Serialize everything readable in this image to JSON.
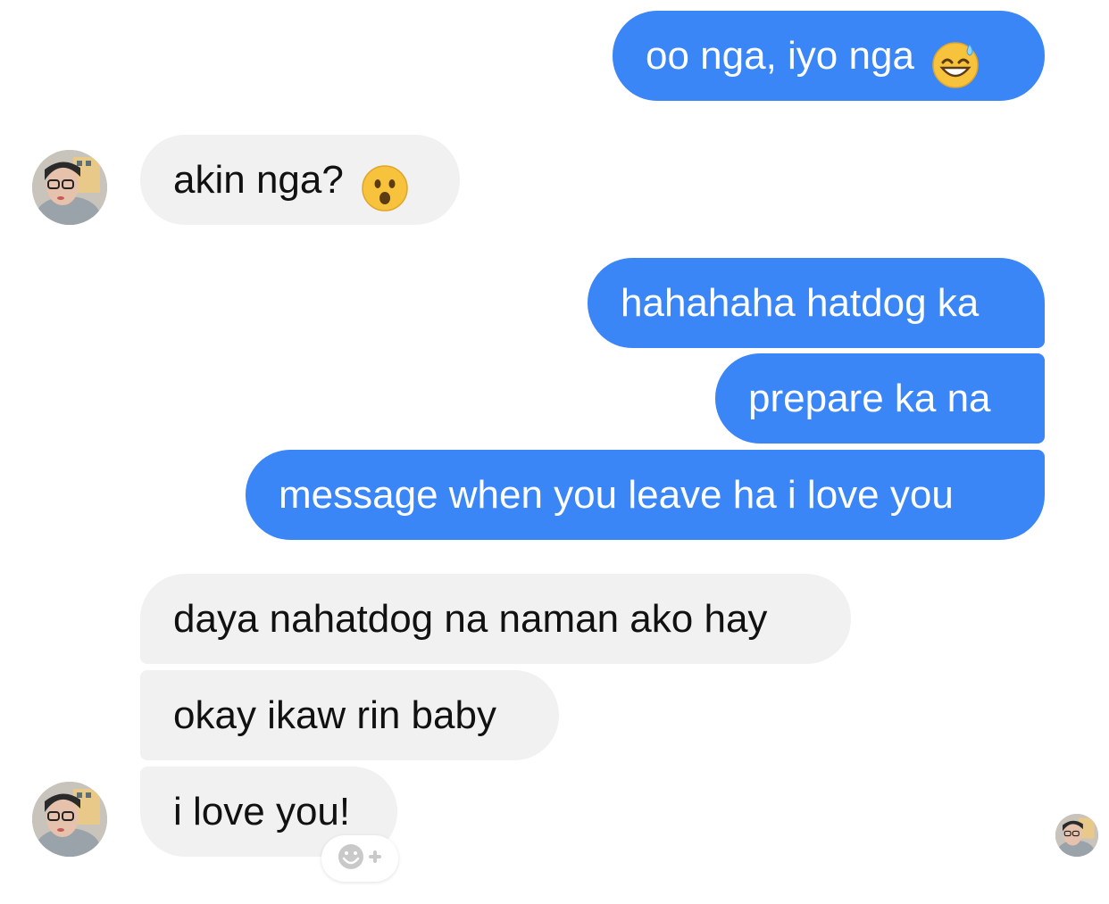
{
  "messages": [
    {
      "id": "m1",
      "direction": "outgoing",
      "text": "oo nga, iyo nga",
      "emoji": "grinning-sweat-emoji"
    },
    {
      "id": "m2",
      "direction": "incoming",
      "text": "akin nga?",
      "emoji": "surprised-emoji"
    },
    {
      "id": "m3",
      "direction": "outgoing",
      "text": "hahahaha hatdog ka"
    },
    {
      "id": "m4",
      "direction": "outgoing",
      "text": "prepare ka na"
    },
    {
      "id": "m5",
      "direction": "outgoing",
      "text": "message when you leave ha i love you"
    },
    {
      "id": "m6",
      "direction": "incoming",
      "text": "daya nahatdog na naman ako hay"
    },
    {
      "id": "m7",
      "direction": "incoming",
      "text": "okay ikaw rin baby"
    },
    {
      "id": "m8",
      "direction": "incoming",
      "text": "i love you!"
    }
  ],
  "reaction_button": {
    "icon": "add-reaction-icon"
  },
  "colors": {
    "outgoing_bubble": "#3a86f7",
    "incoming_bubble": "#f1f1f1",
    "background": "#ffffff"
  }
}
